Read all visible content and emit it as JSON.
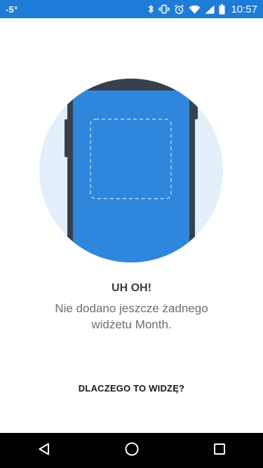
{
  "status_bar": {
    "temperature": "-5°",
    "time": "10:57",
    "icons": [
      "bluetooth-icon",
      "vibrate-icon",
      "alarm-icon",
      "wifi-icon",
      "signal-icon",
      "battery-icon"
    ]
  },
  "illustration": {
    "icon": "phone-widget-placeholder",
    "colors": {
      "circle": "#e3f0fc",
      "phone_body": "#37404f",
      "screen": "#2f87dd",
      "dashed": "#b9d8f5"
    }
  },
  "message": {
    "title": "UH OH!",
    "body": "Nie dodano jeszcze żadnego widżetu Month."
  },
  "link": {
    "label": "DLACZEGO TO WIDZĘ?"
  },
  "nav_bar": {
    "buttons": [
      "back-icon",
      "home-icon",
      "recents-icon"
    ]
  },
  "colors": {
    "status_bar": "#1f7bd8",
    "nav_bar": "#000000"
  }
}
